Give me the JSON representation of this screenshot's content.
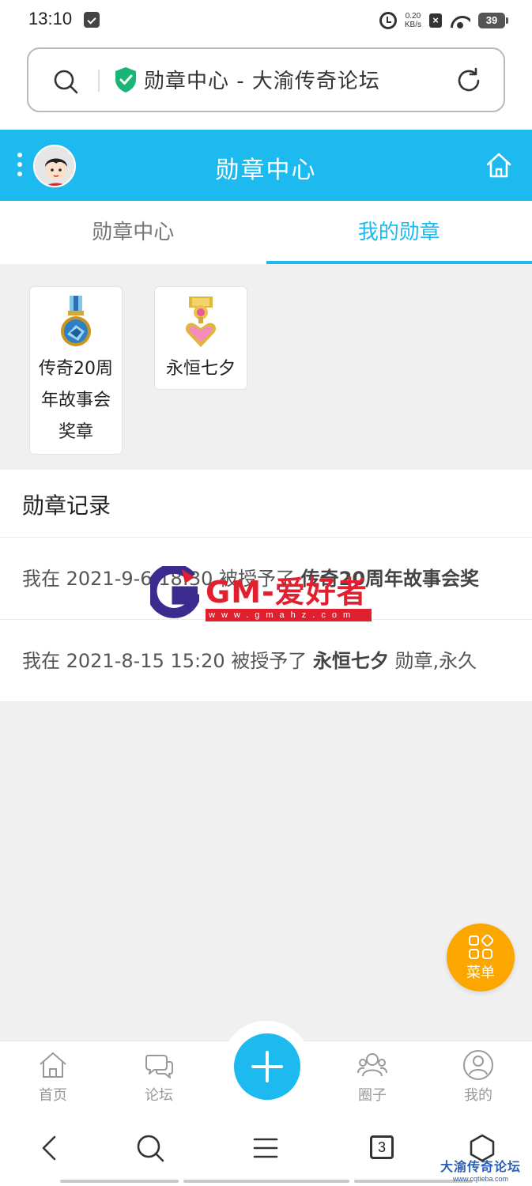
{
  "status_bar": {
    "time": "13:10",
    "net_speed_value": "0.20",
    "net_speed_unit": "KB/s",
    "battery": "39",
    "icons": [
      "note-icon",
      "alarm-icon",
      "no-sim-icon",
      "wifi-icon",
      "battery-icon"
    ]
  },
  "browser": {
    "url_title": "勋章中心 - 大渝传奇论坛",
    "icons": [
      "search-icon",
      "secure-shield-icon",
      "reload-icon"
    ]
  },
  "header": {
    "title": "勋章中心",
    "icons": [
      "more-dots-icon",
      "avatar",
      "home-icon"
    ]
  },
  "tabs": [
    {
      "label": "勋章中心",
      "active": false
    },
    {
      "label": "我的勋章",
      "active": true
    }
  ],
  "badges": [
    {
      "name_line1": "传奇20周",
      "name_line2": "年故事会",
      "name_line3": "奖章",
      "icon": "blue-medal-icon"
    },
    {
      "name_line1": "永恒七夕",
      "icon": "heart-medal-icon"
    }
  ],
  "records": {
    "title": "勋章记录",
    "items": [
      {
        "prefix": "我在 2021-9-6 18:30 被授予了",
        "medal": "传奇20周年故事会奖",
        "suffix": ""
      },
      {
        "prefix": "我在 2021-8-15 15:20 被授予了",
        "medal": "永恒七夕",
        "suffix": "勋章,永久"
      }
    ]
  },
  "watermark": {
    "text": "GM-爱好者",
    "url": "www.gmahz.com"
  },
  "fab": {
    "label": "菜单",
    "icon": "menu-grid-icon"
  },
  "bottom_nav": [
    {
      "label": "首页",
      "icon": "home-icon"
    },
    {
      "label": "论坛",
      "icon": "chat-icon"
    },
    {
      "label": "",
      "icon": "plus-icon"
    },
    {
      "label": "圈子",
      "icon": "group-icon"
    },
    {
      "label": "我的",
      "icon": "user-icon"
    }
  ],
  "system_nav": {
    "tab_count": "3",
    "corner_brand": "大渝传奇论坛",
    "corner_url": "www.cqtieba.com"
  },
  "colors": {
    "accent": "#1cbaee",
    "fab": "#fca600",
    "watermark": "#e0202e"
  }
}
